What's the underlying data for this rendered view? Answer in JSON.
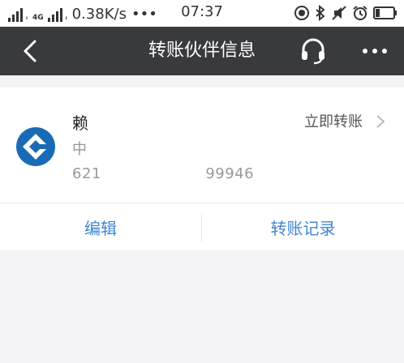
{
  "status_bar": {
    "network_generation": "4G",
    "network_speed": "0.38K/s",
    "more_indicator": "•••",
    "time": "07:37",
    "icons": [
      "signal-icon",
      "location-icon",
      "bluetooth-icon",
      "mute-icon",
      "alarm-icon",
      "battery-icon"
    ]
  },
  "header": {
    "title": "转账伙伴信息",
    "back_icon": "chevron-left-icon",
    "service_icon": "headset-icon",
    "more_icon": "more-dots-icon"
  },
  "partner": {
    "name": "赖",
    "bank": "中",
    "account_prefix": "621",
    "account_suffix": "99946",
    "transfer_now_label": "立即转账",
    "bank_logo_color": "#1a6bb5"
  },
  "actions": {
    "edit_label": "编辑",
    "records_label": "转账记录"
  },
  "colors": {
    "header_bg": "#393a3d",
    "link_blue": "#3f86d2",
    "page_bg": "#f3f3f5"
  }
}
